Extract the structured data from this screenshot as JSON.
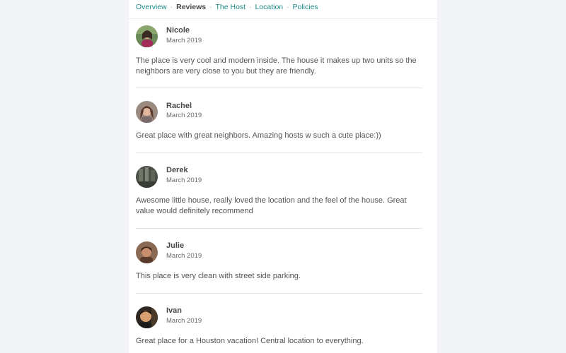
{
  "nav": {
    "items": [
      {
        "label": "Overview",
        "active": false
      },
      {
        "label": "Reviews",
        "active": true
      },
      {
        "label": "The Host",
        "active": false
      },
      {
        "label": "Location",
        "active": false
      },
      {
        "label": "Policies",
        "active": false
      }
    ],
    "separator": "·"
  },
  "reviews": [
    {
      "name": "Nicole",
      "date": "March 2019",
      "text": "The place is very cool and modern inside. The house it makes up two units so the neighbors are very close to you but they are friendly."
    },
    {
      "name": "Rachel",
      "date": "March 2019",
      "text": "Great place with great neighbors. Amazing hosts w such a cute place:))"
    },
    {
      "name": "Derek",
      "date": "March 2019",
      "text": "Awesome little house, really loved the location and the feel of the house. Great value would definitely recommend"
    },
    {
      "name": "Julie",
      "date": "March 2019",
      "text": "This place is very clean with street side parking."
    },
    {
      "name": "Ivan",
      "date": "March 2019",
      "text": "Great place for a Houston vacation! Central location to everything."
    }
  ],
  "colors": {
    "link": "#1f8a8a",
    "active_link": "#484848",
    "text": "#555555",
    "background": "#f2f4f8"
  }
}
